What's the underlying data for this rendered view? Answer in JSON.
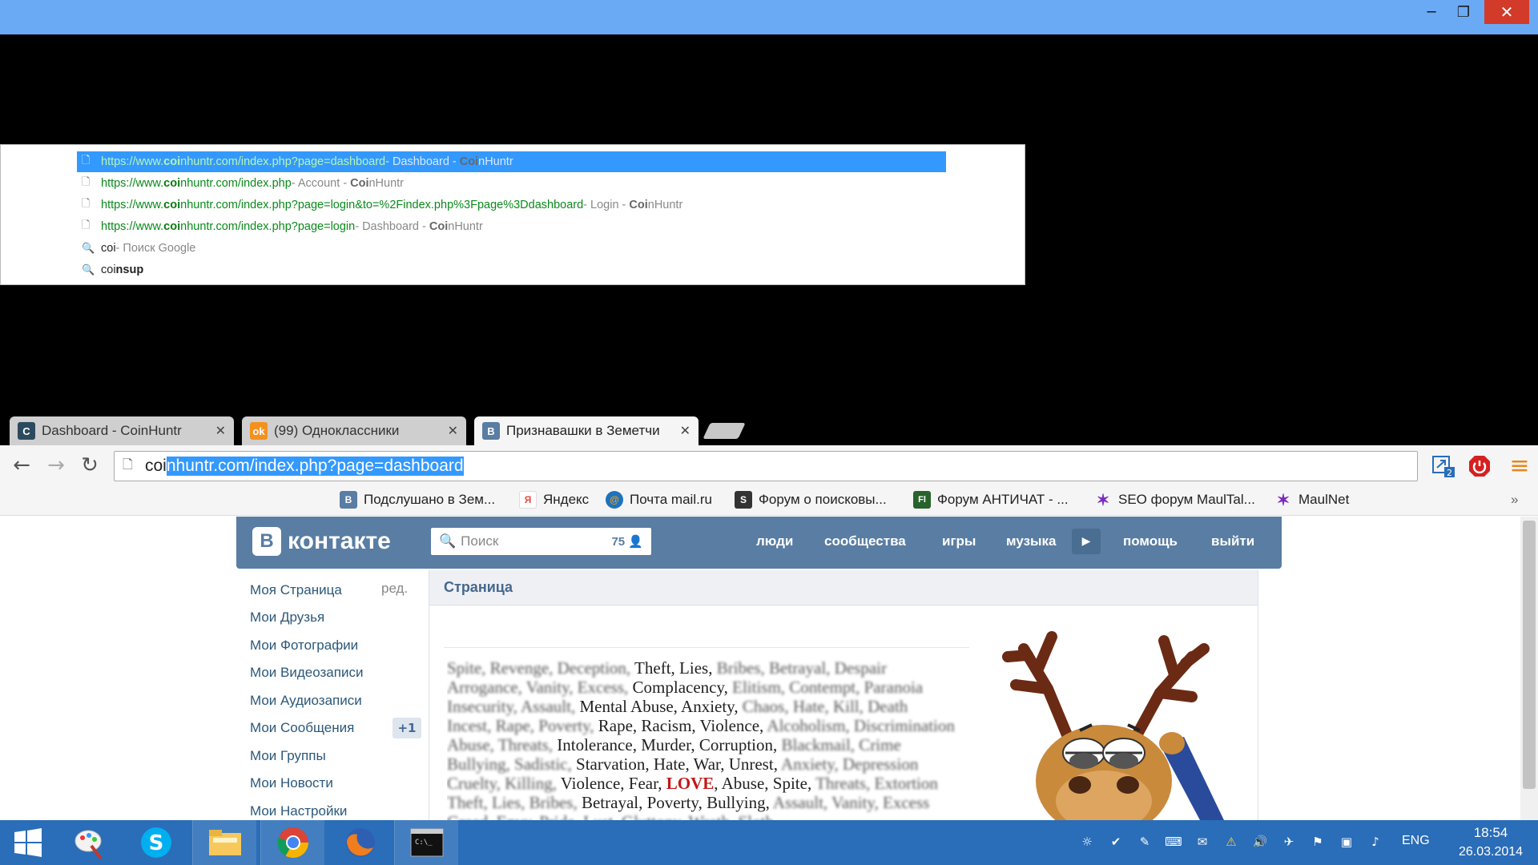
{
  "window": {
    "minimize_glyph": "─",
    "maximize_glyph": "❐",
    "close_glyph": "✕"
  },
  "omnibox_dropdown": {
    "suggestions": [
      {
        "url_pre": "https://www.",
        "url_bold": "coi",
        "url_post": "nhuntr.com/index.php?page=dashboard",
        "sep": " - ",
        "desc_pre": "Dashboard - ",
        "desc_bold": "Coi",
        "desc_post": "nHuntr",
        "selected": true
      },
      {
        "url_pre": "https://www.",
        "url_bold": "coi",
        "url_post": "nhuntr.com/index.php",
        "sep": " - ",
        "desc_pre": "Account - ",
        "desc_bold": "Coi",
        "desc_post": "nHuntr",
        "selected": false
      },
      {
        "url_pre": "https://www.",
        "url_bold": "coi",
        "url_post": "nhuntr.com/index.php?page=login&to=%2Findex.php%3Fpage%3Ddashboard",
        "sep": " - ",
        "desc_pre": "Login - ",
        "desc_bold": "Coi",
        "desc_post": "nHuntr",
        "selected": false
      },
      {
        "url_pre": "https://www.",
        "url_bold": "coi",
        "url_post": "nhuntr.com/index.php?page=login",
        "sep": " - ",
        "desc_pre": "Dashboard - ",
        "desc_bold": "Coi",
        "desc_post": "nHuntr",
        "selected": false
      }
    ],
    "search_1": {
      "query": "coi",
      "suffix": " - Поиск Google"
    },
    "search_2": {
      "typed": "coi",
      "completion": "nsup"
    }
  },
  "tabs": [
    {
      "title": "Dashboard - CoinHuntr",
      "favicon": "C",
      "favicon_color": "#2c4a5e"
    },
    {
      "title": "(99) Одноклассники",
      "favicon": "ok",
      "favicon_color": "#f4911e"
    },
    {
      "title": "Признавашки в Земетчи",
      "favicon": "В",
      "favicon_color": "#597da3"
    }
  ],
  "tab_close_glyph": "✕",
  "toolbar": {
    "back_glyph": "←",
    "forward_glyph": "→",
    "reload_glyph": "↻",
    "menu_glyph": "≡",
    "omnibox_typed": "coi",
    "omnibox_selected": "nhuntr.com/index.php?page=dashboard",
    "ext_badge": "2"
  },
  "bookmarks": [
    {
      "label": "Подслушано в Зем...",
      "icon": "В",
      "color": "#597da3"
    },
    {
      "label": "Яндекс",
      "icon": "Я",
      "color": "#e74c3c"
    },
    {
      "label": "Почта mail.ru",
      "icon": "@",
      "color": "#f39c12"
    },
    {
      "label": "Форум о поисковы...",
      "icon": "S",
      "color": "#333333"
    },
    {
      "label": "Форум АНТИЧАТ - ...",
      "icon": "Fl",
      "color": "#27632a"
    },
    {
      "label": "SEO форум MaulTal...",
      "icon": "✶",
      "color": "#7b2cbf"
    },
    {
      "label": "MaulNet",
      "icon": "✶",
      "color": "#7b2cbf"
    }
  ],
  "bookmarks_more": "»",
  "vk": {
    "logo_letter": "В",
    "logo_text": "контакте",
    "search_placeholder": "Поиск",
    "search_count": "75",
    "nav": [
      "люди",
      "сообщества",
      "игры",
      "музыка",
      "помощь",
      "выйти"
    ],
    "play_glyph": "▶",
    "menu": [
      "Моя Страница",
      "Мои Друзья",
      "Мои Фотографии",
      "Мои Видеозаписи",
      "Мои Аудиозаписи",
      "Мои Сообщения",
      "Мои Группы",
      "Мои Новости",
      "Мои Настройки"
    ],
    "menu_edit": "ред.",
    "messages_badge": "+1",
    "content_title": "Страница",
    "word_lines": [
      [
        [
          "b",
          "Spite, Revenge, Deception,"
        ],
        [
          "",
          " Theft, Lies,"
        ],
        [
          "b",
          " Bribes, Betrayal, Despair"
        ]
      ],
      [
        [
          "b",
          "Arrogance, Vanity, Excess,"
        ],
        [
          "",
          " Complacency,"
        ],
        [
          "b",
          " Elitism, Contempt, Paranoia"
        ]
      ],
      [
        [
          "b",
          "Insecurity, Assault,"
        ],
        [
          "",
          " Mental Abuse, Anxiety,"
        ],
        [
          "b",
          " Chaos, Hate, Kill, Death"
        ]
      ],
      [
        [
          "b",
          "Incest, Rape, Poverty,"
        ],
        [
          "",
          " Rape, Racism, Violence,"
        ],
        [
          "b",
          " Alcoholism, Discrimination"
        ]
      ],
      [
        [
          "b",
          "Abuse, Threats,"
        ],
        [
          "",
          " Intolerance, Murder, Corruption,"
        ],
        [
          "b",
          " Blackmail, Crime"
        ]
      ],
      [
        [
          "b",
          "Bullying, Sadistic,"
        ],
        [
          "",
          " Starvation, Hate, War, Unrest,"
        ],
        [
          "b",
          " Anxiety, Depression"
        ]
      ],
      [
        [
          "b",
          "Cruelty, Killing,"
        ],
        [
          "",
          " Violence, Fear, "
        ],
        [
          "love",
          "LOVE"
        ],
        [
          "",
          ", Abuse, Spite,"
        ],
        [
          "b",
          " Threats, Extortion"
        ]
      ],
      [
        [
          "b",
          "Theft, Lies, Bribes,"
        ],
        [
          "",
          " Betrayal, Poverty, Bullying,"
        ],
        [
          "b",
          " Assault, Vanity, Excess"
        ]
      ],
      [
        [
          "b",
          "Greed, Envy, Pride, Lust, Gluttony, Wrath, Sloth"
        ]
      ]
    ]
  },
  "taskbar": {
    "lang": "ENG",
    "time": "18:54",
    "date": "26.03.2014",
    "tray": [
      "☼",
      "✔",
      "✎",
      "⌨",
      "✉",
      "⚠",
      "🔊",
      "✈",
      "⚑",
      "▣",
      "♪"
    ]
  },
  "colors": {
    "titlebar": "#6aaaf5",
    "vk_blue": "#597da3",
    "selection": "#3399ff",
    "taskbar": "#2a6db8"
  }
}
